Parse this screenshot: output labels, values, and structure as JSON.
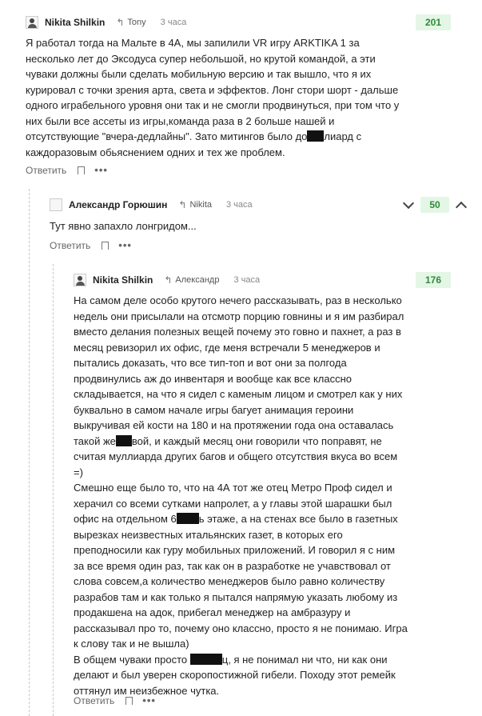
{
  "comments": [
    {
      "author": "Nikita Shilkin",
      "reply_to": "Tony",
      "time": "3 часа",
      "score": "201",
      "paragraphs": [
        [
          "Я работал тогда на Мальте в 4А, мы запилили VR игру ARKTIKA 1 за несколько лет до Эксодуса супер небольшой, но крутой командой, а эти чуваки должны были сделать мобильную версию и так вышло, что я их курировал с точки зрения арта, света и эффектов. Лонг стори шорт - дальше одного играбельного уровня они так и не смогли продвинуться, при том что у них были все ассеты из игры,команда раза в 2 больше нашей и отсутствующие \"вчера-дедлайны\". Зато митингов было до",
          "лиард с каждоразовым обьяснением одних и тех же проблем."
        ]
      ],
      "reply_label": "Ответить"
    },
    {
      "author": "Александр Горюшин",
      "reply_to": "Nikita",
      "time": "3 часа",
      "score": "50",
      "paragraphs": [
        [
          "Тут явно запахло лонгридом..."
        ]
      ],
      "reply_label": "Ответить"
    },
    {
      "author": "Nikita Shilkin",
      "reply_to": "Александр",
      "time": "3 часа",
      "score": "176",
      "paragraphs": [
        [
          "На самом деле особо крутого нечего рассказывать, раз в несколько недель они присылали на отсмотр порцию говнины и я им разбирал вместо делания полезных вещей почему это говно и пахнет, а раз в месяц ревизорил их офис, где меня встречали 5 менеджеров и пытались доказать, что все тип-топ и вот они за полгода продвинулись аж до инвентаря и вообще как все классно складывается, на что я сидел с каменым лицом и смотрел как у них буквально в самом начале игры багует анимация героини выкручивая ей кости на 180 и на протяжении года она оставалась такой же",
          "вой, и каждый месяц они говорили что поправят, не считая муллиарда других багов и общего отсутствия вкуса во всем =)"
        ],
        [
          "Смешно еще было то, что на 4А тот же отец Метро Проф сидел и херачил со всеми сутками напролет, а у главы этой шарашки был офис на отдельном 6",
          "ь этаже, а на стенах все было в газетных вырезках неизвестных итальянских газет, в которых его преподносили как гуру мобильных приложений. И говорил я с ним за все время один раз, так как он в разработке не учавствовал от слова совсем,а количество менеджеров было равно количеству разрабов там и как только я пытался напрямую указать любому из продакшена на адок, прибегал менеджер на амбразуру и рассказывал про то, почему оно классно, просто я не понимаю. Игра к слову так и не вышла)"
        ],
        [
          "В общем чуваки просто",
          "ц, я не понимал ни что, ни как они делают и был уверен скоропостижной гибели. Походу этот ремейк оттянул им неизбежное чутка."
        ]
      ],
      "reply_label": "Ответить"
    }
  ]
}
